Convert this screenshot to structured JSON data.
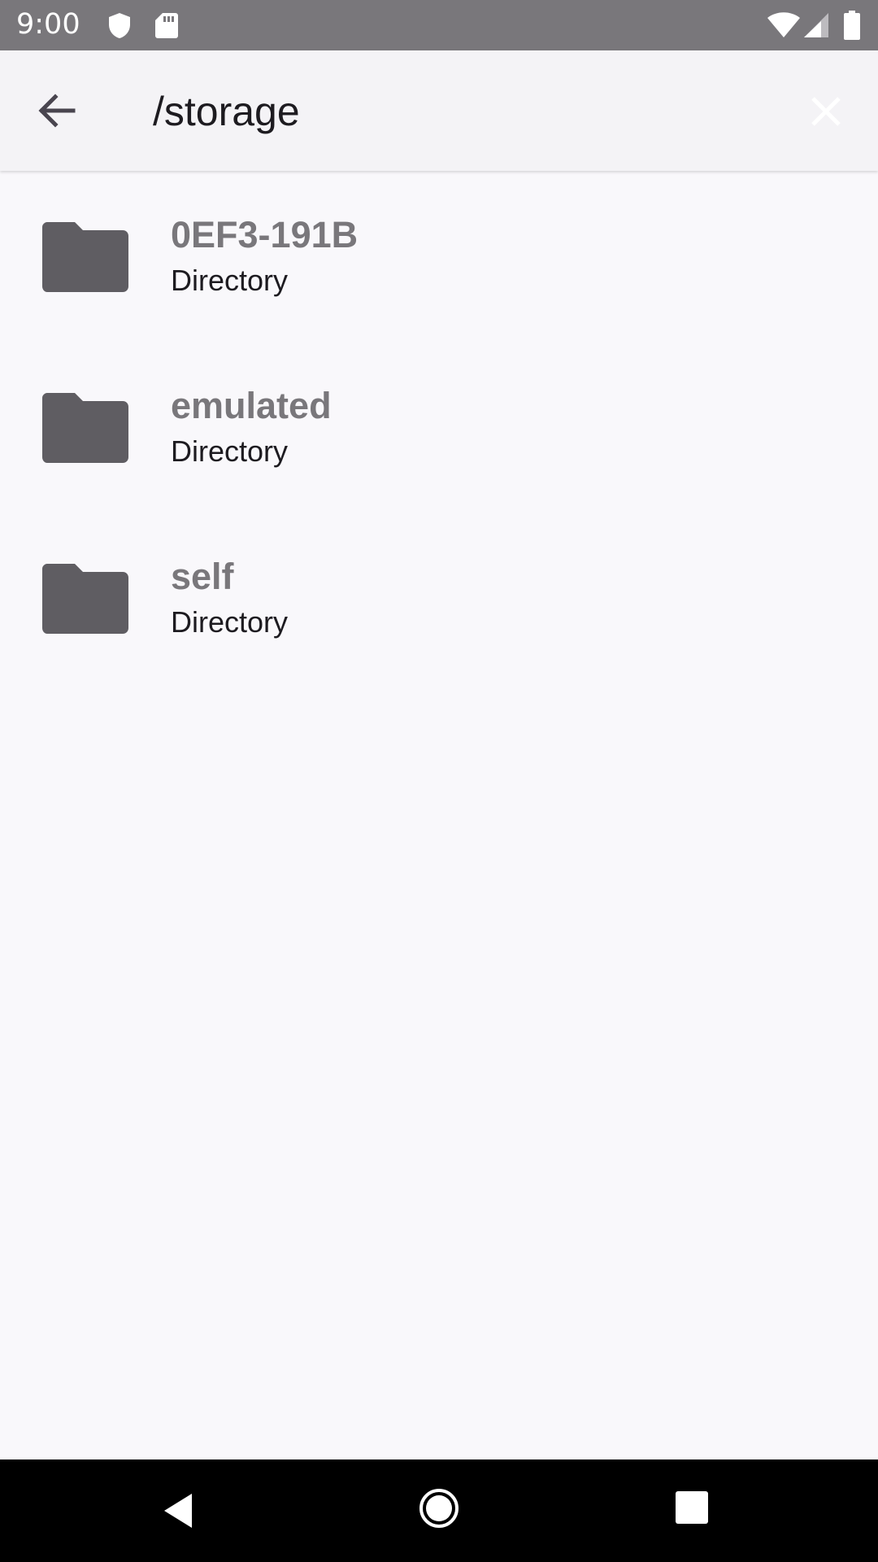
{
  "status_bar": {
    "time": "9:00",
    "icons": [
      "shield-icon",
      "sd-card-icon",
      "wifi-icon",
      "signal-icon",
      "battery-icon"
    ]
  },
  "app_bar": {
    "back_icon": "arrow-back-icon",
    "title": "/storage",
    "close_icon": "close-icon"
  },
  "directories": [
    {
      "name": "0EF3-191B",
      "type": "Directory",
      "icon": "folder-icon"
    },
    {
      "name": "emulated",
      "type": "Directory",
      "icon": "folder-icon"
    },
    {
      "name": "self",
      "type": "Directory",
      "icon": "folder-icon"
    }
  ],
  "nav_bar": {
    "icons": [
      "nav-back-icon",
      "nav-home-icon",
      "nav-recents-icon"
    ]
  },
  "colors": {
    "status_bar": "#79777b",
    "app_bar": "#f4f3f6",
    "background": "#f9f8fb",
    "folder": "#5f5d62",
    "dir_name": "#79777b",
    "text": "#1d1b20"
  }
}
